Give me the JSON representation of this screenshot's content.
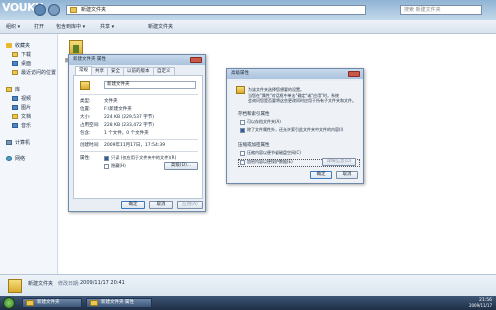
{
  "explorer": {
    "logo": "VOUKU",
    "address": "新建文件夹",
    "search_placeholder": "搜索 新建文件夹",
    "toolbar": {
      "organize": "组织 ▾",
      "open": "打开",
      "include": "包含到库中 ▾",
      "share": "共享 ▾",
      "new_folder": "新建文件夹"
    },
    "nav": {
      "favorites": "收藏夹",
      "downloads": "下载",
      "desktop": "桌面",
      "recent": "最近访问的位置",
      "libraries": "库",
      "videos": "视频",
      "pictures": "图片",
      "documents": "文档",
      "music": "音乐",
      "computer": "计算机",
      "network": "网络"
    },
    "file": {
      "name": "新建文件夹"
    },
    "details": {
      "name": "新建文件夹",
      "modified_label": "修改日期:",
      "modified": "2009/11/17 20:41"
    }
  },
  "properties_dialog": {
    "title": "新建文件夹 属性",
    "tabs": [
      "常规",
      "共享",
      "安全",
      "以前的版本",
      "自定义"
    ],
    "name_value": "新建文件夹",
    "rows": {
      "type_label": "类型:",
      "type_value": "文件夹",
      "location_label": "位置:",
      "location_value": "F:\\新建文件夹",
      "size_label": "大小:",
      "size_value": "224 KB (229,537 字节)",
      "disk_label": "占用空间:",
      "disk_value": "228 KB (233,472 字节)",
      "contains_label": "包含:",
      "contains_value": "1 个文件，0 个文件夹",
      "created_label": "创建时间:",
      "created_value": "2009年11月17日，17:54:39",
      "attr_label": "属性:"
    },
    "attrs": {
      "readonly": "只读 (仅应用于文件夹中的文件)(R)",
      "hidden": "隐藏(H)"
    },
    "advanced_btn": "高级(D)...",
    "ok": "确定",
    "cancel": "取消",
    "apply": "应用(A)"
  },
  "advanced_dialog": {
    "title": "高级属性",
    "intro1": "为该文件夹选择您想要的设置。",
    "intro2": "当您在\"属性\"对话框中单击\"确定\"或\"应用\"时，系统",
    "intro3": "会询问您是否要将这些更改同时应用于所有子文件夹和文件。",
    "archive_head": "存档和索引属性",
    "archive": "可以存档文件夹(A)",
    "index": "除了文件属性外，还允许索引此文件夹中文件的内容(I)",
    "compress_head": "压缩或加密属性",
    "compress": "压缩内容以便节省磁盘空间(C)",
    "encrypt": "加密内容以便保护数据(E)",
    "details_btn": "详细信息(D)",
    "ok": "确定",
    "cancel": "取消"
  },
  "taskbar": {
    "task1": "新建文件夹",
    "task2": "新建文件夹 属性",
    "time": "21:56",
    "date": "2009/11/17"
  }
}
